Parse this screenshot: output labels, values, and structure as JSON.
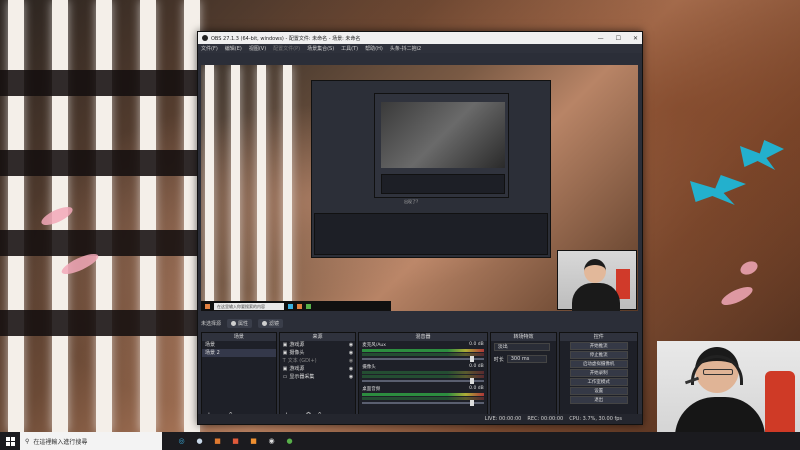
{
  "obs": {
    "window_title": "OBS 27.1.3 (64-bit, windows) - 配置文件: 未命名 - 场景: 未命名",
    "window_buttons": [
      "—",
      "☐",
      "✕"
    ],
    "menu": [
      "文件(F)",
      "编辑(E)",
      "视图(V)",
      "配置文件(P)",
      "场景集合(S)",
      "工具(T)",
      "帮助(H)",
      "头条-抖二抱i2"
    ],
    "preview_caption": "出现了?",
    "preview_search_text": "在这里输入你要搜索的内容",
    "scene_status_label": "未选择源",
    "properties_label": "属性",
    "filters_label": "滤镜",
    "scenes_header": "场景",
    "scenes": [
      "场景",
      "场景 2"
    ],
    "sources_header": "来源",
    "sources": [
      {
        "label": "游戏源",
        "icon": "game-icon"
      },
      {
        "label": "摄像头",
        "icon": "camera-icon"
      },
      {
        "label": "文本 (GDI+)",
        "icon": "text-icon"
      },
      {
        "label": "游戏源",
        "icon": "game-icon"
      },
      {
        "label": "显示器采集",
        "icon": "monitor-icon"
      }
    ],
    "mixer_header": "混音器",
    "mixer_channels": [
      {
        "name": "麦克风/Aux",
        "db": "0.0 dB"
      },
      {
        "name": "摄像头",
        "db": "0.0 dB"
      },
      {
        "name": "桌面音频",
        "db": "0.0 dB"
      }
    ],
    "transitions_header": "转场特效",
    "transition_type": "淡出",
    "duration_label": "时长",
    "duration_value": "300 ms",
    "controls_header": "控件",
    "controls": [
      "开始推流",
      "停止推流",
      "启动虚拟摄像机",
      "开始录制",
      "工作室模式",
      "设置",
      "退出"
    ],
    "status": {
      "live": "LIVE: 00:00:00",
      "rec": "REC: 00:00:00",
      "cpu": "CPU: 3.7%, 30.00 fps"
    }
  },
  "taskbar": {
    "search_placeholder": "在這裡輸入進行搜尋",
    "apps": [
      {
        "name": "cortana-icon",
        "glyph": "◎",
        "color": "#3ab0e0"
      },
      {
        "name": "steam-icon",
        "glyph": "●",
        "color": "#c8d8e8"
      },
      {
        "name": "app-orange-icon",
        "glyph": "■",
        "color": "#e07a30"
      },
      {
        "name": "app-red-icon",
        "glyph": "■",
        "color": "#e05a3a"
      },
      {
        "name": "app-orange2-icon",
        "glyph": "■",
        "color": "#f09030"
      },
      {
        "name": "obs-icon",
        "glyph": "◉",
        "color": "#dddddd"
      },
      {
        "name": "chrome-icon",
        "glyph": "●",
        "color": "#58b04a"
      }
    ]
  },
  "colors": {
    "obs_background": "#2b2e38",
    "webcam_chair": "#cf3a26",
    "wallpaper_petal": "#f2a8b8",
    "butterfly": "#1fb6d6"
  }
}
